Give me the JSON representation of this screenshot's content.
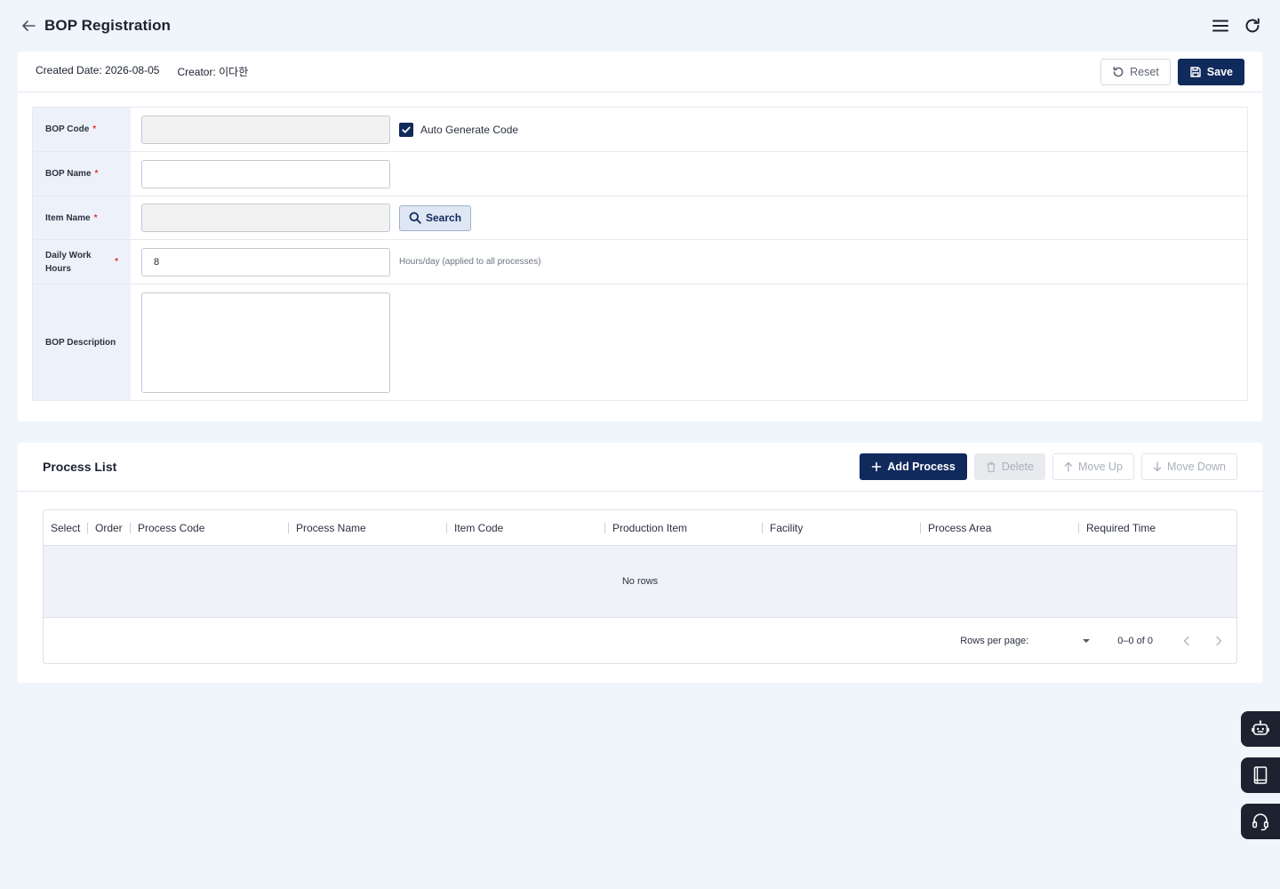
{
  "header": {
    "title": "BOP Registration",
    "back_icon": "arrow-left-icon",
    "menu_icon": "hamburger-menu-icon",
    "refresh_icon": "refresh-icon"
  },
  "meta": {
    "created_date": "Created Date: 2026-08-05",
    "creator": "Creator: 이다한",
    "reset_label": "Reset",
    "save_label": "Save"
  },
  "form": {
    "bop_code_label": "BOP Code",
    "bop_code_value": "",
    "auto_generate_label": "Auto Generate Code",
    "auto_generate_checked": true,
    "bop_name_label": "BOP Name",
    "bop_name_value": "",
    "item_name_label": "Item Name",
    "item_name_value": "",
    "search_label": "Search",
    "daily_hours_label": "Daily Work Hours",
    "daily_hours_value": "8",
    "daily_hours_hint": "Hours/day (applied to all processes)",
    "description_label": "BOP Description",
    "description_value": "",
    "required_mark": "*"
  },
  "process_list": {
    "title": "Process List",
    "add_label": "Add Process",
    "delete_label": "Delete",
    "move_up_label": "Move Up",
    "move_down_label": "Move Down",
    "columns": [
      "Select",
      "Order",
      "Process Code",
      "Process Name",
      "Item Code",
      "Production Item",
      "Facility",
      "Process Area",
      "Required Time"
    ],
    "empty_text": "No rows",
    "rows_per_page_label": "Rows per page:",
    "rows_per_page_value": "",
    "pagination_info": "0–0 of 0"
  },
  "floating": {
    "items": [
      "chatbot-icon",
      "manual-book-icon",
      "support-headset-icon"
    ]
  },
  "colors": {
    "primary": "#102a5c",
    "background": "#f0f4fb",
    "label_bg": "#edf2fa",
    "required": "#e0353b"
  }
}
